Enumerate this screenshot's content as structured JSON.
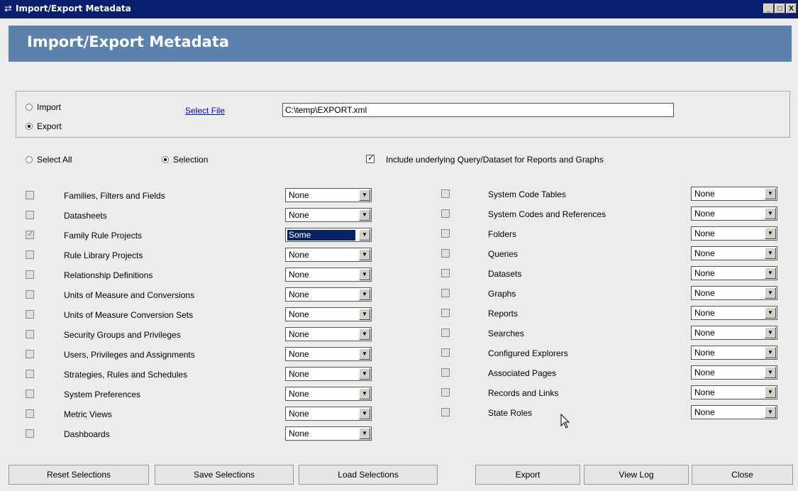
{
  "window": {
    "title": "Import/Export Metadata",
    "controls": [
      "_",
      "□",
      "X"
    ]
  },
  "header": {
    "title": "Import/Export Metadata"
  },
  "mode": {
    "import_label": "Import",
    "export_label": "Export",
    "selected": "Export",
    "select_file_link": "Select File",
    "file_path": "C:\\temp\\EXPORT.xml"
  },
  "scope": {
    "select_all_label": "Select All",
    "selection_label": "Selection",
    "selected": "Selection",
    "include_label": "Include underlying Query/Dataset for Reports and Graphs",
    "include_checked": true
  },
  "left_items": [
    {
      "label": "Families, Filters and Fields",
      "value": "None",
      "checked": false
    },
    {
      "label": "Datasheets",
      "value": "None",
      "checked": false
    },
    {
      "label": "Family Rule Projects",
      "value": "Some",
      "checked": true,
      "highlight": true
    },
    {
      "label": "Rule Library Projects",
      "value": "None",
      "checked": false
    },
    {
      "label": "Relationship Definitions",
      "value": "None",
      "checked": false
    },
    {
      "label": "Units of Measure and Conversions",
      "value": "None",
      "checked": false
    },
    {
      "label": "Units of Measure Conversion Sets",
      "value": "None",
      "checked": false
    },
    {
      "label": "Security Groups and Privileges",
      "value": "None",
      "checked": false
    },
    {
      "label": "Users, Privileges and Assignments",
      "value": "None",
      "checked": false
    },
    {
      "label": "Strategies, Rules and Schedules",
      "value": "None",
      "checked": false
    },
    {
      "label": "System Preferences",
      "value": "None",
      "checked": false
    },
    {
      "label": "Metric Views",
      "value": "None",
      "checked": false
    },
    {
      "label": "Dashboards",
      "value": "None",
      "checked": false
    }
  ],
  "right_items": [
    {
      "label": "System Code Tables",
      "value": "None",
      "checked": false
    },
    {
      "label": "System Codes and References",
      "value": "None",
      "checked": false
    },
    {
      "label": "Folders",
      "value": "None",
      "checked": false
    },
    {
      "label": "Queries",
      "value": "None",
      "checked": false
    },
    {
      "label": "Datasets",
      "value": "None",
      "checked": false
    },
    {
      "label": "Graphs",
      "value": "None",
      "checked": false
    },
    {
      "label": "Reports",
      "value": "None",
      "checked": false
    },
    {
      "label": "Searches",
      "value": "None",
      "checked": false
    },
    {
      "label": "Configured Explorers",
      "value": "None",
      "checked": false
    },
    {
      "label": "Associated Pages",
      "value": "None",
      "checked": false
    },
    {
      "label": "Records and Links",
      "value": "None",
      "checked": false
    },
    {
      "label": "State Roles",
      "value": "None",
      "checked": false
    }
  ],
  "buttons": {
    "reset": "Reset Selections",
    "save": "Save Selections",
    "load": "Load Selections",
    "export": "Export",
    "view_log": "View Log",
    "close": "Close"
  }
}
